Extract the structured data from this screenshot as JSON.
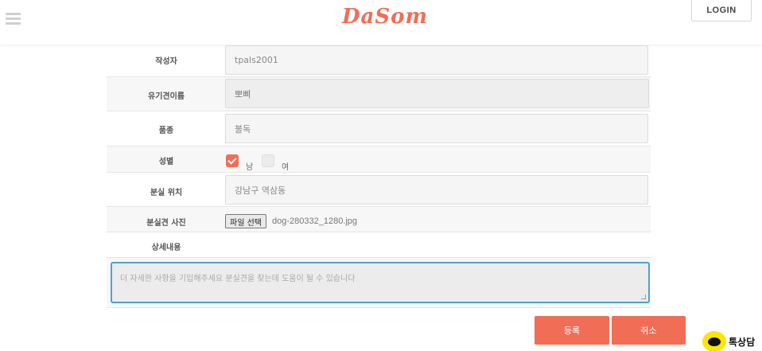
{
  "header": {
    "logo": "DaSom",
    "login_label": "LOGIN"
  },
  "form": {
    "author": {
      "label": "작성자",
      "value": "tpals2001"
    },
    "dog_name": {
      "label": "유기견이름",
      "value": "뽀삐"
    },
    "breed": {
      "label": "품종",
      "value": "불독"
    },
    "gender": {
      "label": "성별",
      "option_male": "남",
      "option_female": "여",
      "selected": "남"
    },
    "lost_location": {
      "label": "분실 위치",
      "value": "강남구 역삼동"
    },
    "photo": {
      "label": "분실견 사진",
      "button_label": "파일 선택",
      "file_name": "dog-280332_1280.jpg"
    },
    "details": {
      "label": "상세내용",
      "placeholder": "더 자세한 사항을 기입해주세요 분실견을 찾는데 도움이 될 수 있습니다"
    }
  },
  "actions": {
    "submit_label": "등록",
    "cancel_label": "취소"
  },
  "kakao": {
    "label": "톡상담"
  },
  "colors": {
    "accent": "#f26d55",
    "focus": "#4aa3d6",
    "kakao": "#fee500"
  }
}
